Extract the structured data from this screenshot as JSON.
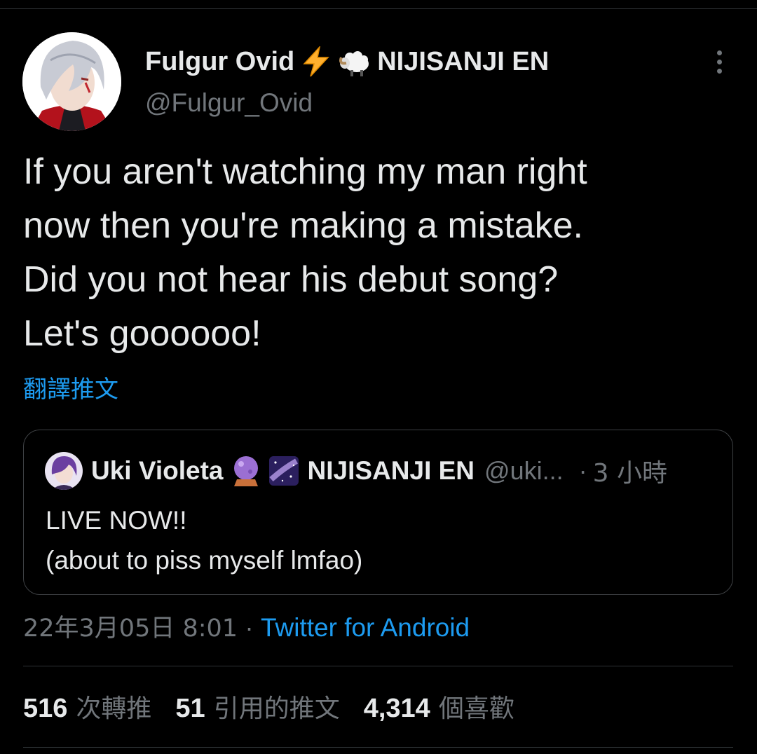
{
  "tweet": {
    "author": {
      "display_name": "Fulgur Ovid",
      "name_emojis": [
        "lightning-emoji",
        "ram-emoji"
      ],
      "org": "NIJISANJI EN",
      "handle": "@Fulgur_Ovid"
    },
    "text": "If you aren't watching my man right\nnow then you're making a mistake.\nDid you not hear his debut song?\nLet's goooooo!",
    "translate_label": "翻譯推文",
    "quoted": {
      "display_name": "Uki Violeta",
      "name_emojis": [
        "crystal-ball-emoji",
        "milky-way-emoji"
      ],
      "org": "NIJISANJI EN",
      "handle": "@uki...",
      "separator": "·",
      "time": "3 小時",
      "text": "LIVE NOW!!\n(about to piss myself lmfao)"
    },
    "meta": {
      "date": "22年3月05日 8:01",
      "separator": "·",
      "source": "Twitter for Android"
    },
    "stats": [
      {
        "value": "516",
        "label": "次轉推"
      },
      {
        "value": "51",
        "label": "引用的推文"
      },
      {
        "value": "4,314",
        "label": "個喜歡"
      }
    ]
  },
  "colors": {
    "background": "#000000",
    "text_primary": "#e7e9ea",
    "text_secondary": "#71767b",
    "link": "#1d9bf0",
    "border": "#2f3336"
  }
}
